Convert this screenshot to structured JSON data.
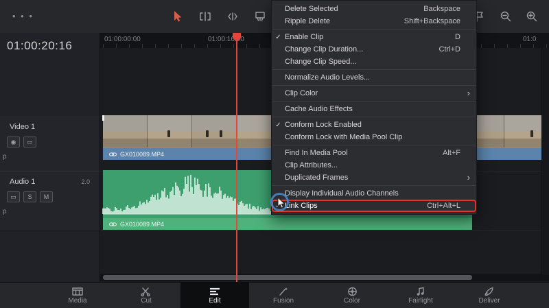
{
  "toolbar": {
    "more_glyph": "• • •",
    "tools": [
      {
        "name": "pointer-tool-icon",
        "active": true
      },
      {
        "name": "trim-edit-tool-icon",
        "active": false
      },
      {
        "name": "dynamic-trim-tool-icon",
        "active": false
      },
      {
        "name": "razor-tool-icon",
        "active": false
      }
    ],
    "right_tools": [
      {
        "name": "snap-magnet-icon"
      },
      {
        "name": "flag-marker-icon"
      },
      {
        "name": "zoom-out-icon"
      },
      {
        "name": "zoom-in-icon"
      }
    ]
  },
  "timecode": {
    "value": "01:00:20:16"
  },
  "ruler": {
    "labels": [
      {
        "text": "01:00:00:00"
      },
      {
        "text": "01:00:16:00"
      },
      {
        "text": "01:0"
      }
    ]
  },
  "track_headers": {
    "video": {
      "name": "Video 1",
      "overflow_text": "p"
    },
    "audio": {
      "name": "Audio 1",
      "format": "2.0",
      "solo": "S",
      "mute": "M",
      "overflow_text": "p"
    }
  },
  "clips": {
    "video": {
      "filename": "GX010089.MP4"
    },
    "audio": {
      "filename": "GX010089.MP4"
    }
  },
  "menu": {
    "checkmark_glyph": "✓",
    "submenu_glyph": "›",
    "items": [
      {
        "label": "Delete Selected",
        "shortcut": "Backspace"
      },
      {
        "label": "Ripple Delete",
        "shortcut": "Shift+Backspace"
      },
      {
        "separator": true
      },
      {
        "label": "Enable Clip",
        "shortcut": "D",
        "checked": true
      },
      {
        "label": "Change Clip Duration...",
        "shortcut": "Ctrl+D"
      },
      {
        "label": "Change Clip Speed..."
      },
      {
        "separator": true
      },
      {
        "label": "Normalize Audio Levels..."
      },
      {
        "separator": true
      },
      {
        "label": "Clip Color",
        "submenu": true
      },
      {
        "separator": true
      },
      {
        "label": "Cache Audio Effects"
      },
      {
        "separator": true
      },
      {
        "label": "Conform Lock Enabled",
        "checked": true
      },
      {
        "label": "Conform Lock with Media Pool Clip"
      },
      {
        "separator": true
      },
      {
        "label": "Find In Media Pool",
        "shortcut": "Alt+F"
      },
      {
        "label": "Clip Attributes..."
      },
      {
        "label": "Duplicated Frames",
        "submenu": true
      },
      {
        "separator": true
      },
      {
        "label": "Display Individual Audio Channels"
      },
      {
        "label": "Link Clips",
        "shortcut": "Ctrl+Alt+L",
        "checked": true,
        "highlighted": true
      }
    ]
  },
  "bottom_nav": {
    "items": [
      {
        "label": "Media",
        "icon": "media-page-icon",
        "active": false
      },
      {
        "label": "Cut",
        "icon": "cut-page-icon",
        "active": false
      },
      {
        "label": "Edit",
        "icon": "edit-page-icon",
        "active": true
      },
      {
        "label": "Fusion",
        "icon": "fusion-page-icon",
        "active": false
      },
      {
        "label": "Color",
        "icon": "color-page-icon",
        "active": false
      },
      {
        "label": "Fairlight",
        "icon": "fairlight-page-icon",
        "active": false
      },
      {
        "label": "Deliver",
        "icon": "deliver-page-icon",
        "active": false
      }
    ]
  },
  "colors": {
    "accent_red": "#e5453a",
    "clip_blue": "#5b83ab",
    "clip_green": "#3d9e6e",
    "clip_green_bar": "#4fb27b",
    "highlight_red": "#e93123",
    "cursor_ring_blue": "#4a90d9"
  }
}
